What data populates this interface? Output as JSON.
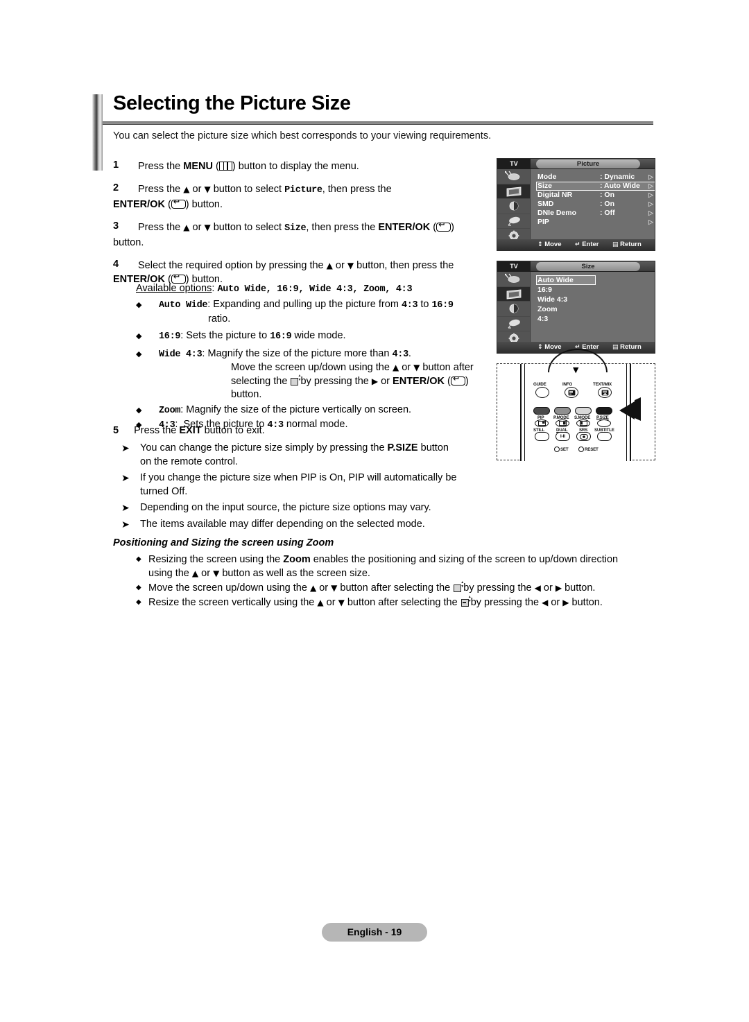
{
  "page": {
    "title": "Selecting the Picture Size",
    "intro": "You can select the picture size which best corresponds to your viewing requirements.",
    "footer_label": "English - 19"
  },
  "steps": [
    {
      "num": "1",
      "text_a": "Press the ",
      "bold_a": "MENU",
      "paren_icon": "menu-icon",
      "text_b": ") button to display the menu."
    },
    {
      "num": "2",
      "line1_a": "Press the ",
      "line1_b": " or ",
      "line1_c": " button to select ",
      "mono": "Picture",
      "line1_d": ", then press the",
      "line2_bold": "ENTER/OK",
      "line2_end": ") button."
    },
    {
      "num": "3",
      "line1_a": "Press the ",
      "line1_b": " or ",
      "line1_c": " button to select ",
      "mono": "Size",
      "line1_d": ", then press the ",
      "line1_bold": "ENTER/OK",
      "line1_e": ")",
      "line2": "button."
    },
    {
      "num": "4",
      "line1": "Select the required option by pressing the ",
      "line1_mid": " or ",
      "line1_end": " button, then press the",
      "line2_bold": "ENTER/OK",
      "line2_end": ") button."
    },
    {
      "num": "5",
      "text_a": "Press the ",
      "bold": "EXIT",
      "text_b": " button to exit."
    }
  ],
  "options": {
    "available_label": "Available options",
    "available_sep": ": ",
    "available_values": "Auto Wide, 16:9, Wide 4:3, Zoom, 4:3",
    "items": [
      {
        "name": "Auto Wide",
        "colon": ":",
        "desc_a": "Expanding and pulling up the picture from ",
        "desc_mono1": "4:3",
        "desc_b": " to ",
        "desc_mono2": "16:9",
        "desc_cont": "ratio."
      },
      {
        "name": "16:9",
        "colon": ":",
        "desc_a": "Sets the picture to ",
        "desc_mono1": "16:9",
        "desc_b": " wide mode."
      },
      {
        "name": "Wide 4:3",
        "colon": ":",
        "desc_a": "Magnify the size of the picture more than ",
        "desc_mono1": "4:3",
        "desc_b": ".",
        "sub_line1_a": "Move the screen up/down using the ",
        "sub_line1_b": " or ",
        "sub_line1_c": " button after",
        "sub_line2_a": "selecting the ",
        "sub_line2_b": " by pressing the ",
        "sub_line2_c": " or ",
        "sub_line2_bold": "ENTER/OK",
        "sub_line2_d": ")",
        "sub_line3": "button."
      },
      {
        "name": "Zoom",
        "colon": ":",
        "desc_a": "Magnify the size of the picture vertically on screen."
      },
      {
        "name": "4:3",
        "colon": ":",
        "desc_a": "Sets the picture to ",
        "desc_mono1": "4:3",
        "desc_b": " normal mode."
      }
    ]
  },
  "notes": [
    {
      "line1_a": "You can change the picture size simply by pressing the ",
      "bold": "P.SIZE",
      "line1_b": " button",
      "line2": "on the remote control."
    },
    {
      "line1_a": "If you change the picture size when PIP is On, PIP will automatically be",
      "line2": "turned Off."
    },
    {
      "line1_a": "Depending on the input source, the picture size options may vary."
    },
    {
      "line1_a": "The items available may differ depending on the selected mode."
    }
  ],
  "zoom_section": {
    "heading": "Positioning and Sizing the screen using Zoom",
    "lines": [
      {
        "a": "Resizing the screen using the ",
        "bold": "Zoom",
        "b": " enables the positioning and sizing of the screen to up/down direction",
        "line2_a": "using the ",
        "line2_b": " or ",
        "line2_c": " button as well as the screen size."
      },
      {
        "a": "Move the screen up/down using the ",
        "b": " or ",
        "c": " button after selecting the ",
        "d": " by pressing the ",
        "e": " or ",
        "f": " button."
      },
      {
        "a": "Resize the screen vertically using the ",
        "b": " or ",
        "c": " button after selecting the ",
        "d": " by pressing the ",
        "e": " or ",
        "f": " button."
      }
    ]
  },
  "osd_picture": {
    "tv_label": "TV",
    "tab_title": "Picture",
    "rows": [
      {
        "label": "Mode",
        "value": ": Dynamic",
        "selected": false
      },
      {
        "label": "Size",
        "value": ": Auto Wide",
        "selected": true
      },
      {
        "label": "Digital NR",
        "value": ": On",
        "selected": false
      },
      {
        "label": "SMD",
        "value": ": On",
        "selected": false
      },
      {
        "label": "DNIe Demo",
        "value": ": Off",
        "selected": false
      },
      {
        "label": "PIP",
        "value": "",
        "selected": false
      }
    ],
    "footer": {
      "move": "Move",
      "enter": "Enter",
      "return": "Return"
    },
    "icons": [
      "antenna-icon",
      "picture-icon",
      "sound-icon",
      "dish-icon",
      "setup-gear-icon"
    ]
  },
  "osd_size": {
    "tv_label": "TV",
    "tab_title": "Size",
    "options": [
      {
        "label": "Auto Wide",
        "selected": true
      },
      {
        "label": "16:9",
        "selected": false
      },
      {
        "label": "Wide 4:3",
        "selected": false
      },
      {
        "label": "Zoom",
        "selected": false
      },
      {
        "label": "4:3",
        "selected": false
      }
    ],
    "footer": {
      "move": "Move",
      "enter": "Enter",
      "return": "Return"
    },
    "icons": [
      "antenna-icon",
      "picture-icon",
      "sound-icon",
      "dish-icon",
      "setup-gear-icon"
    ]
  },
  "remote": {
    "row_top": [
      "GUIDE",
      "INFO",
      "TEXT/MIX"
    ],
    "row_color": [
      "PIP",
      "P.MODE",
      "S.MODE",
      "P.SIZE"
    ],
    "row_bottom": [
      "STILL",
      "DUAL",
      "SRS",
      "SUBTITLE"
    ],
    "dual_glyph": "I-II",
    "small_buttons": [
      "SET",
      "RESET"
    ],
    "highlight_target": "P.SIZE"
  },
  "colors": {
    "osd_bg": "#6f6f6f",
    "osd_dark": "#1d1d1d",
    "footer_pill": "#b6b6b6",
    "text": "#000000"
  }
}
